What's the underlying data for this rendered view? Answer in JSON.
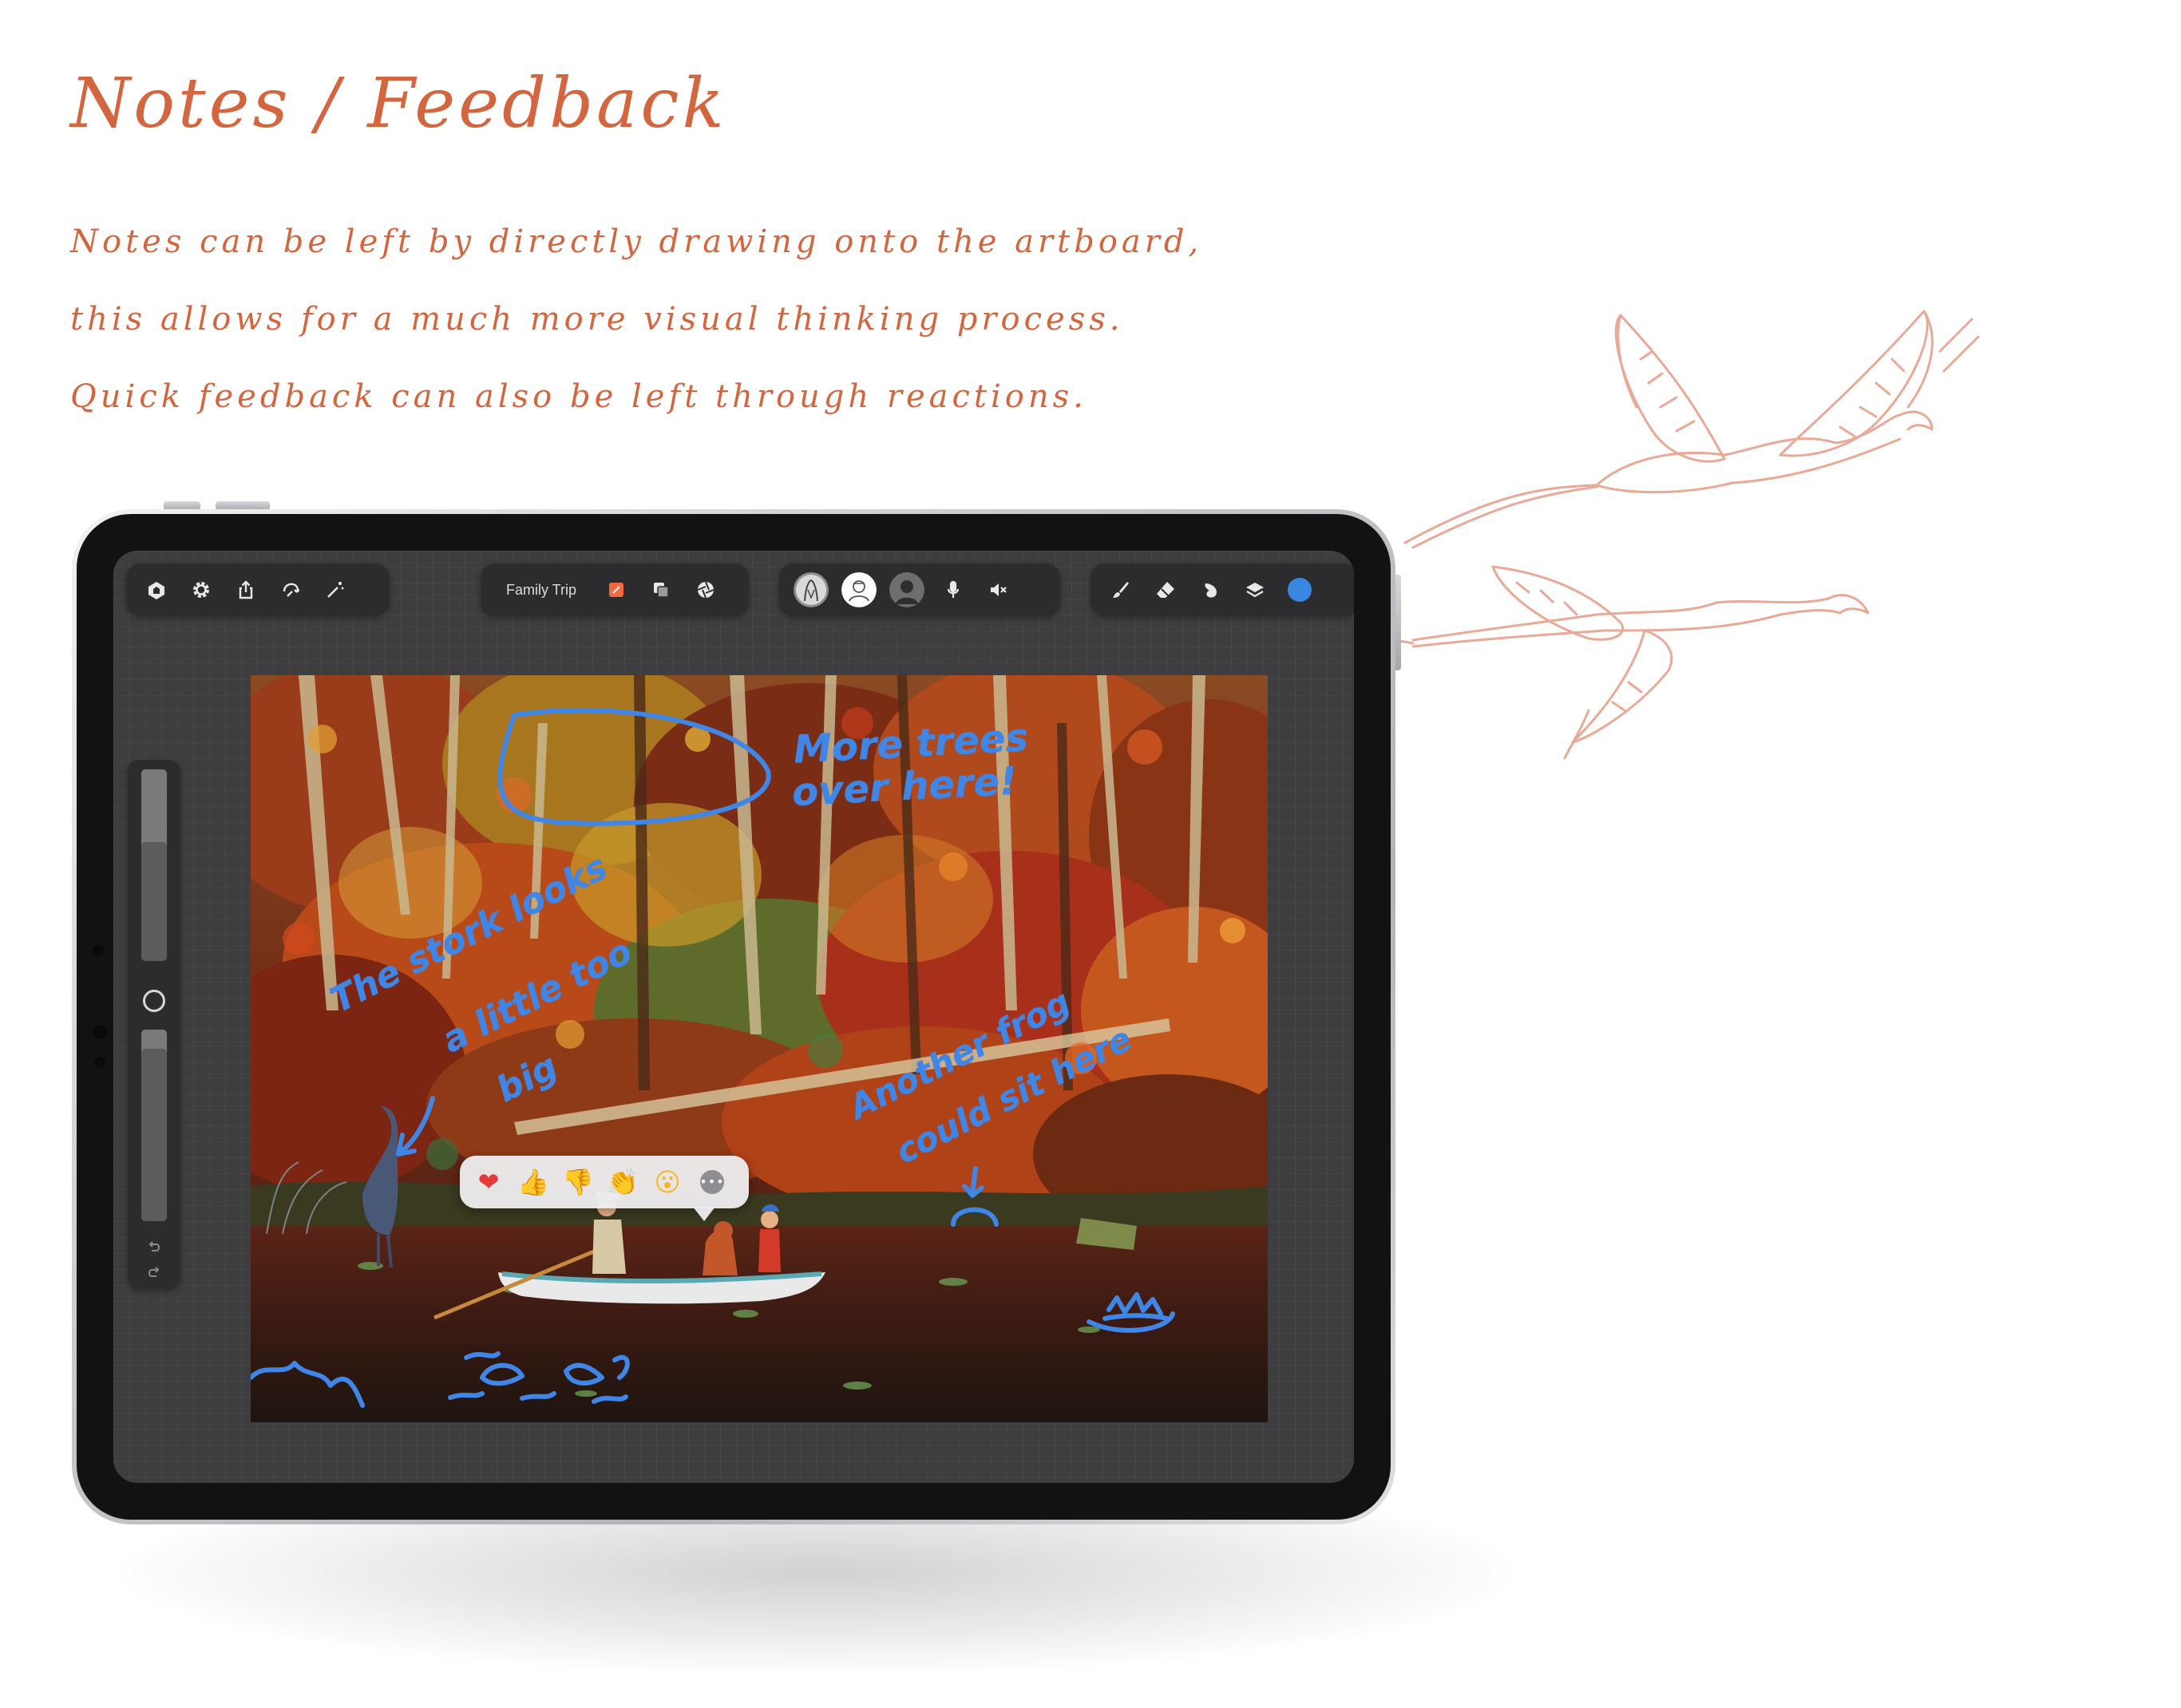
{
  "header": {
    "title": "Notes / Feedback",
    "description_lines": [
      "Notes can be left by directly drawing onto the artboard,",
      "this allows for a much more visual thinking process.",
      "Quick feedback can also be left through reactions."
    ]
  },
  "colors": {
    "accent": "#d4663f",
    "annotation": "#3f86e6",
    "brush_color": "#3a86e3",
    "document_icon": "#f06a3d"
  },
  "toolbar": {
    "left_icons": [
      "gallery-icon",
      "settings-icon",
      "share-icon",
      "transform-icon",
      "magic-wand-icon"
    ],
    "document_name": "Family Trip",
    "document_icons": [
      "document-icon",
      "layers-copy-icon",
      "aperture-icon"
    ],
    "collaborators": [
      "collaborator-avatar-1",
      "collaborator-avatar-2",
      "collaborator-avatar-3"
    ],
    "audio_icons": [
      "microphone-icon",
      "speaker-muted-icon"
    ],
    "tool_icons": [
      "brush-icon",
      "eraser-icon",
      "smudge-icon",
      "layers-icon"
    ]
  },
  "annotations": {
    "trees_note_line1": "More trees",
    "trees_note_line2": "over here!",
    "stork_note_line1": "The stork looks",
    "stork_note_line2": "a little too",
    "stork_note_line3": "big",
    "frog_note_line1": "Another frog",
    "frog_note_line2": "could sit here"
  },
  "reactions": {
    "items": [
      "❤",
      "👍",
      "👎",
      "👏",
      "😮"
    ],
    "more_label": "•••"
  }
}
